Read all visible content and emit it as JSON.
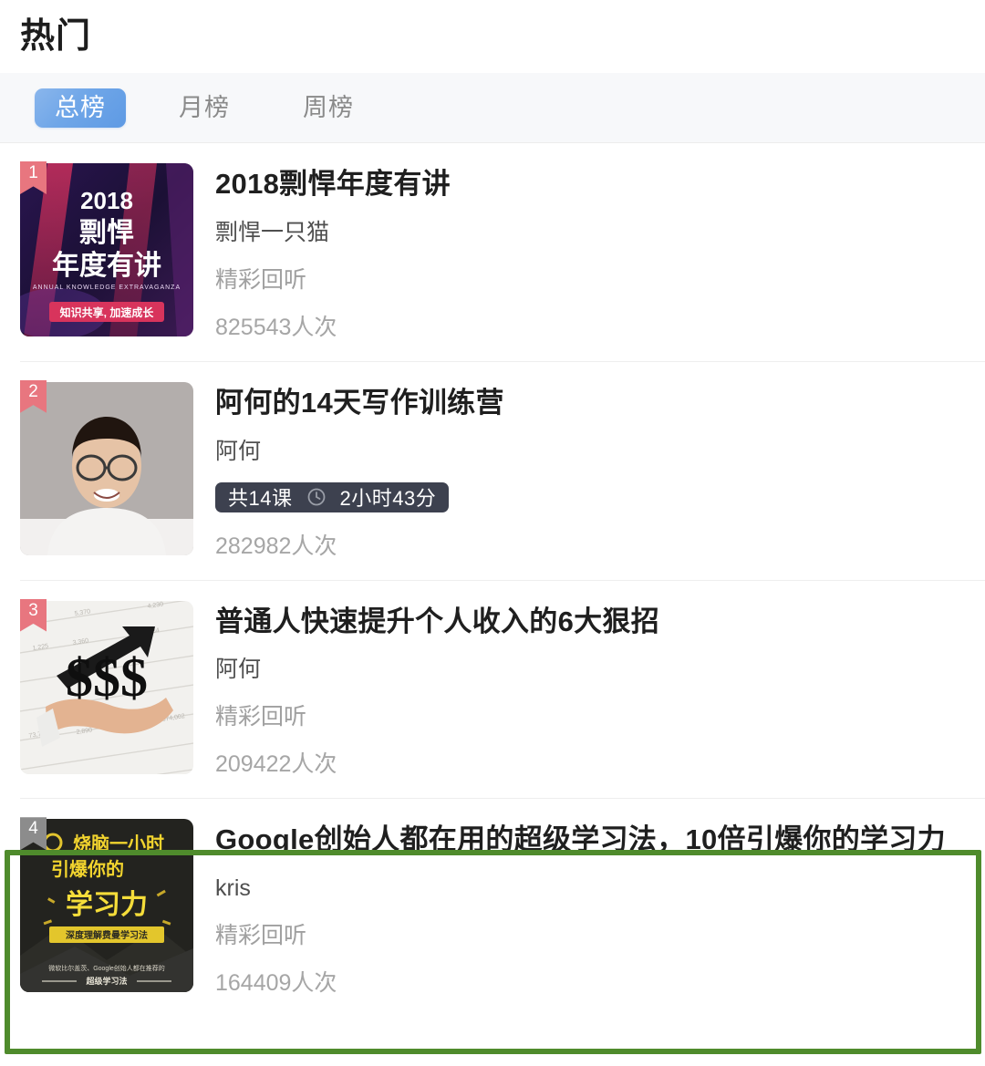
{
  "header": {
    "title": "热门"
  },
  "tabs": [
    {
      "label": "总榜",
      "active": true
    },
    {
      "label": "月榜",
      "active": false
    },
    {
      "label": "周榜",
      "active": false
    }
  ],
  "colors": {
    "accent_blue": "#6fa6e8",
    "rank_badge_pink": "#e8767f",
    "rank_badge_gray": "#8c8c8c",
    "meta_badge_dark": "#3d414f",
    "highlight_green": "#4f8b2c",
    "title_text": "#1f1f1f",
    "muted_text": "#a0a0a0"
  },
  "list": {
    "items": [
      {
        "rank": "1",
        "rank_style": "pink",
        "title": "2018剽悍年度有讲",
        "author": "剽悍一只猫",
        "subtitle": "精彩回听",
        "count": "825543人次",
        "thumb_alt": "2018剽悍年度有讲 海报",
        "highlighted": false
      },
      {
        "rank": "2",
        "rank_style": "pink",
        "title": "阿何的14天写作训练营",
        "author": "阿何",
        "meta": {
          "lessons": "共14课",
          "clock_icon": "clock-icon",
          "duration": "2小时43分"
        },
        "count": "282982人次",
        "thumb_alt": "阿何 头像",
        "highlighted": false
      },
      {
        "rank": "3",
        "rank_style": "pink",
        "title": "普通人快速提升个人收入的6大狠招",
        "author": "阿何",
        "subtitle": "精彩回听",
        "count": "209422人次",
        "thumb_alt": "手托美元符号 图片",
        "highlighted": false
      },
      {
        "rank": "4",
        "rank_style": "gray",
        "title": "Google创始人都在用的超级学习法，10倍引爆你的学习力",
        "author": "kris",
        "subtitle": "精彩回听",
        "count": "164409人次",
        "thumb_alt": "烧脑一小时 引爆你的学习力 海报",
        "highlighted": true
      }
    ]
  }
}
